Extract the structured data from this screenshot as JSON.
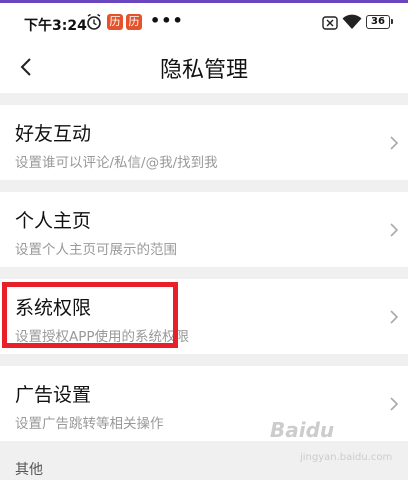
{
  "status_bar": {
    "time": "下午3:24",
    "badge1": "历",
    "badge2": "历",
    "more": "•••",
    "battery": "36",
    "icons": [
      "alarm-icon",
      "app-badge-icon",
      "app-badge-icon",
      "notification-off-icon",
      "wifi-icon",
      "battery-icon"
    ]
  },
  "nav": {
    "title": "隐私管理",
    "back_icon": "chevron-left-icon"
  },
  "settings": [
    {
      "title": "好友互动",
      "subtitle": "设置谁可以评论/私信/@我/找到我"
    },
    {
      "title": "个人主页",
      "subtitle": "设置个人主页可展示的范围"
    },
    {
      "title": "系统权限",
      "subtitle": "设置授权APP使用的系统权限"
    },
    {
      "title": "广告设置",
      "subtitle": "设置广告跳转等相关操作"
    }
  ],
  "section_other": "其他",
  "watermark": {
    "text": "Baidu",
    "sub": "jingyan.baidu.com"
  },
  "colors": {
    "accent": "#6b46c1",
    "highlight": "#e8202a",
    "badge": "#e5532d"
  }
}
